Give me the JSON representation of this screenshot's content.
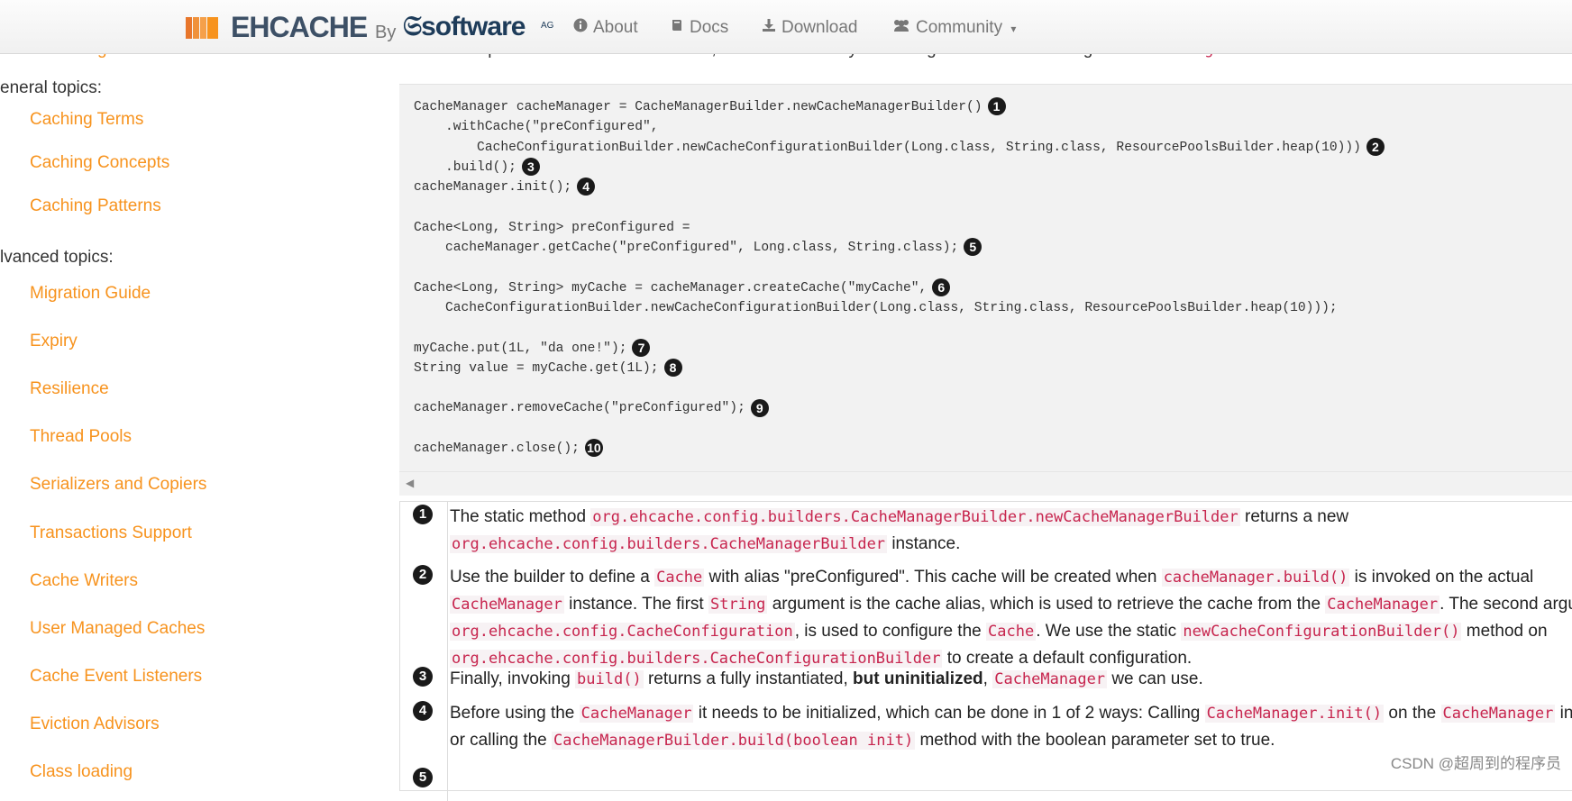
{
  "navbar": {
    "brand_name": "EHCACHE",
    "brand_by": "By",
    "brand_software": "software",
    "brand_ag": "AG",
    "items": [
      {
        "label": "About",
        "icon": "info-circle-icon"
      },
      {
        "label": "Docs",
        "icon": "book-icon"
      },
      {
        "label": "Download",
        "icon": "download-icon"
      },
      {
        "label": "Community",
        "icon": "users-icon"
      }
    ]
  },
  "sidebar": {
    "cut_link": "Clustering with Terracotta",
    "general_heading": "eneral topics:",
    "general_items": [
      "Caching Terms",
      "Caching Concepts",
      "Caching Patterns"
    ],
    "advanced_heading": "lvanced topics:",
    "advanced_items": [
      "Migration Guide",
      "Expiry",
      "Resilience",
      "Thread Pools",
      "Serializers and Copiers",
      "Transactions Support",
      "Cache Writers",
      "User Managed Caches",
      "Cache Event Listeners",
      "Eviction Advisors",
      "Class loading"
    ]
  },
  "intro": {
    "before": "As with the previous versions of Ehcache, the canonical way of dealing with ",
    "code1": "Cache",
    "middle": " is through a ",
    "code2": "CacheManager",
    "after": "."
  },
  "code_lines": [
    {
      "text": "CacheManager cacheManager = CacheManagerBuilder.newCacheManagerBuilder()",
      "callout": "1"
    },
    {
      "text": "    .withCache(\"preConfigured\",",
      "callout": ""
    },
    {
      "text": "        CacheConfigurationBuilder.newCacheConfigurationBuilder(Long.class, String.class, ResourcePoolsBuilder.heap(10)))",
      "callout": "2"
    },
    {
      "text": "    .build();",
      "callout": "3"
    },
    {
      "text": "cacheManager.init();",
      "callout": "4"
    },
    {
      "text": "",
      "callout": ""
    },
    {
      "text": "Cache<Long, String> preConfigured =",
      "callout": ""
    },
    {
      "text": "    cacheManager.getCache(\"preConfigured\", Long.class, String.class);",
      "callout": "5"
    },
    {
      "text": "",
      "callout": ""
    },
    {
      "text": "Cache<Long, String> myCache = cacheManager.createCache(\"myCache\",",
      "callout": "6"
    },
    {
      "text": "    CacheConfigurationBuilder.newCacheConfigurationBuilder(Long.class, String.class, ResourcePoolsBuilder.heap(10)));",
      "callout": ""
    },
    {
      "text": "",
      "callout": ""
    },
    {
      "text": "myCache.put(1L, \"da one!\");",
      "callout": "7"
    },
    {
      "text": "String value = myCache.get(1L);",
      "callout": "8"
    },
    {
      "text": "",
      "callout": ""
    },
    {
      "text": "cacheManager.removeCache(\"preConfigured\");",
      "callout": "9"
    },
    {
      "text": "",
      "callout": ""
    },
    {
      "text": "cacheManager.close();",
      "callout": "10"
    }
  ],
  "callouts": [
    {
      "num": "1",
      "parts": [
        {
          "t": "The static method "
        },
        {
          "c": "org.ehcache.config.builders.CacheManagerBuilder.newCacheManagerBuilder"
        },
        {
          "t": " returns a new "
        },
        {
          "br": true
        },
        {
          "c": "org.ehcache.config.builders.CacheManagerBuilder"
        },
        {
          "t": " instance."
        }
      ]
    },
    {
      "num": "2",
      "parts": [
        {
          "t": "Use the builder to define a "
        },
        {
          "c": "Cache"
        },
        {
          "t": " with alias \"preConfigured\". This cache will be created when "
        },
        {
          "c": "cacheManager.build()"
        },
        {
          "t": " is invoked on the actual "
        },
        {
          "br": true
        },
        {
          "c": "CacheManager"
        },
        {
          "t": " instance. The first "
        },
        {
          "c": "String"
        },
        {
          "t": " argument is the cache alias, which is used to retrieve the cache from the "
        },
        {
          "c": "CacheManager"
        },
        {
          "t": ". The second argur"
        },
        {
          "br": true
        },
        {
          "c": "org.ehcache.config.CacheConfiguration"
        },
        {
          "t": ", is used to configure the "
        },
        {
          "c": "Cache"
        },
        {
          "t": ". We use the static "
        },
        {
          "c": "newCacheConfigurationBuilder()"
        },
        {
          "t": " method on "
        },
        {
          "br": true
        },
        {
          "c": "org.ehcache.config.builders.CacheConfigurationBuilder"
        },
        {
          "t": " to create a default configuration."
        }
      ]
    },
    {
      "num": "3",
      "parts": [
        {
          "t": "Finally, invoking "
        },
        {
          "c": "build()"
        },
        {
          "t": " returns a fully instantiated, "
        },
        {
          "b": "but uninitialized"
        },
        {
          "t": ", "
        },
        {
          "c": "CacheManager"
        },
        {
          "t": " we can use."
        }
      ]
    },
    {
      "num": "4",
      "parts": [
        {
          "t": "Before using the "
        },
        {
          "c": "CacheManager"
        },
        {
          "t": " it needs to be initialized, which can be done in 1 of 2 ways: Calling "
        },
        {
          "c": "CacheManager.init()"
        },
        {
          "t": " on the "
        },
        {
          "c": "CacheManager"
        },
        {
          "t": " insta"
        },
        {
          "br": true
        },
        {
          "t": "or calling the "
        },
        {
          "c": "CacheManagerBuilder.build(boolean init)"
        },
        {
          "t": " method with the boolean parameter set to true."
        }
      ]
    },
    {
      "num": "5",
      "parts": []
    }
  ],
  "watermark": "CSDN @超周到的程序员",
  "colors": {
    "link": "#f7931e",
    "code": "#c7254e",
    "brand": "#3d5066"
  }
}
